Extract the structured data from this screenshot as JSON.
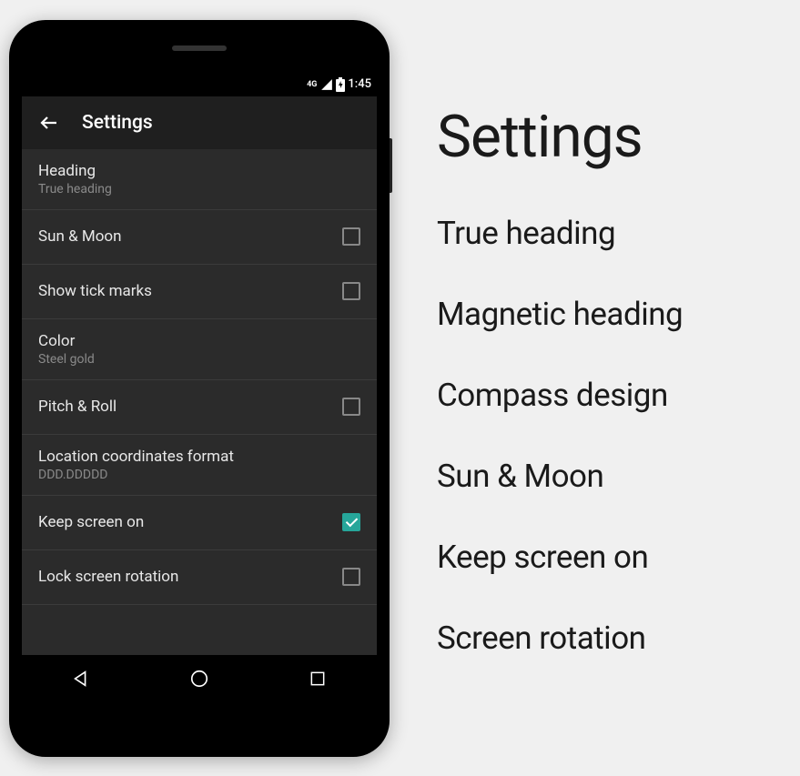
{
  "status_bar": {
    "network": "4G",
    "time": "1:45"
  },
  "app_bar": {
    "title": "Settings"
  },
  "settings": [
    {
      "title": "Heading",
      "subtitle": "True heading",
      "has_checkbox": false
    },
    {
      "title": "Sun & Moon",
      "has_checkbox": true,
      "checked": false
    },
    {
      "title": "Show tick marks",
      "has_checkbox": true,
      "checked": false
    },
    {
      "title": "Color",
      "subtitle": "Steel gold",
      "has_checkbox": false
    },
    {
      "title": "Pitch & Roll",
      "has_checkbox": true,
      "checked": false
    },
    {
      "title": "Location coordinates format",
      "subtitle": "DDD.DDDDD",
      "has_checkbox": false
    },
    {
      "title": "Keep screen on",
      "has_checkbox": true,
      "checked": true
    },
    {
      "title": "Lock screen rotation",
      "has_checkbox": true,
      "checked": false
    }
  ],
  "side": {
    "title": "Settings",
    "items": [
      "True heading",
      "Magnetic heading",
      "Compass design",
      "Sun & Moon",
      "Keep screen on",
      "Screen rotation"
    ]
  }
}
